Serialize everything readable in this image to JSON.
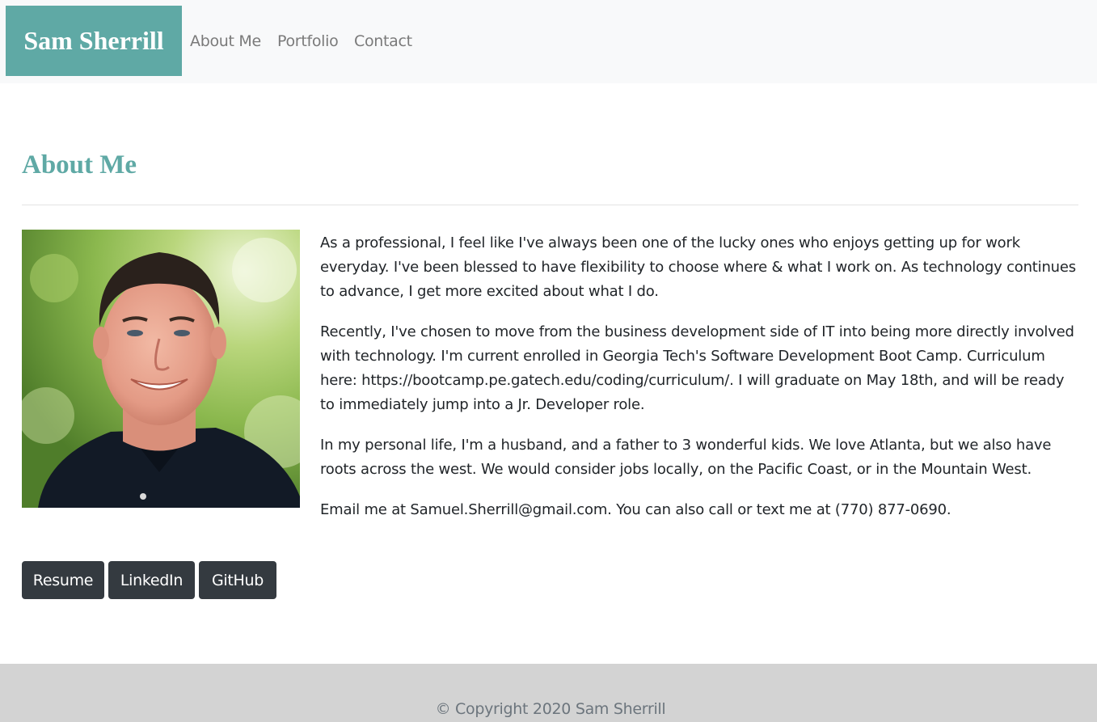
{
  "nav": {
    "brand": "Sam Sherrill",
    "links": [
      "About Me",
      "Portfolio",
      "Contact"
    ]
  },
  "about": {
    "title": "About Me",
    "paragraphs": [
      "As a professional, I feel like I've always been one of the lucky ones who enjoys getting up for work everyday. I've been blessed to have flexibility to choose where & what I work on. As technology continues to advance, I get more excited about what I do.",
      "Recently, I've chosen to move from the business development side of IT into being more directly involved with technology. I'm current enrolled in Georgia Tech's Software Development Boot Camp. Curriculum here: https://bootcamp.pe.gatech.edu/coding/curriculum/. I will graduate on May 18th, and will be ready to immediately jump into a Jr. Developer role.",
      "In my personal life, I'm a husband, and a father to 3 wonderful kids. We love Atlanta, but we also have roots across the west. We would consider jobs locally, on the Pacific Coast, or in the Mountain West.",
      "Email me at Samuel.Sherrill@gmail.com. You can also call or text me at (770) 877-0690."
    ],
    "buttons": [
      "Resume",
      "LinkedIn",
      "GitHub"
    ]
  },
  "footer": {
    "copyright": "© Copyright 2020 Sam Sherrill"
  },
  "colors": {
    "accent": "#5fa9a5",
    "navbar_bg": "#f8f9fa",
    "button_bg": "#343a40",
    "footer_bg": "#d3d3d3"
  },
  "icons": {
    "photo": "profile-photo"
  }
}
